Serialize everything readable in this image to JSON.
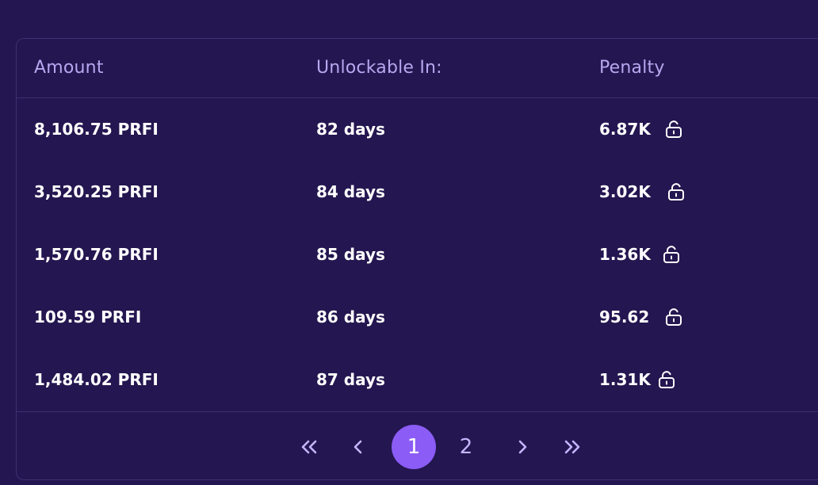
{
  "table": {
    "headers": {
      "amount": "Amount",
      "unlockable": "Unlockable In:",
      "penalty": "Penalty"
    },
    "rows": [
      {
        "amount": "8,106.75 PRFI",
        "unlockable": "82 days",
        "penalty": "6.87K"
      },
      {
        "amount": "3,520.25 PRFI",
        "unlockable": "84 days",
        "penalty": "3.02K"
      },
      {
        "amount": "1,570.76 PRFI",
        "unlockable": "85 days",
        "penalty": "1.36K"
      },
      {
        "amount": "109.59 PRFI",
        "unlockable": "86 days",
        "penalty": "95.62"
      },
      {
        "amount": "1,484.02 PRFI",
        "unlockable": "87 days",
        "penalty": "1.31K"
      }
    ],
    "row_icon": "unlock-icon"
  },
  "pagination": {
    "first_icon": "double-chevron-left-icon",
    "prev_icon": "chevron-left-icon",
    "pages": [
      "1",
      "2"
    ],
    "current_page": "1",
    "next_icon": "chevron-right-icon",
    "last_icon": "double-chevron-right-icon"
  },
  "colors": {
    "background": "#241650",
    "border": "#3e2f72",
    "header_text": "#b7a7f0",
    "accent": "#8b5cf6",
    "text": "#ffffff"
  }
}
